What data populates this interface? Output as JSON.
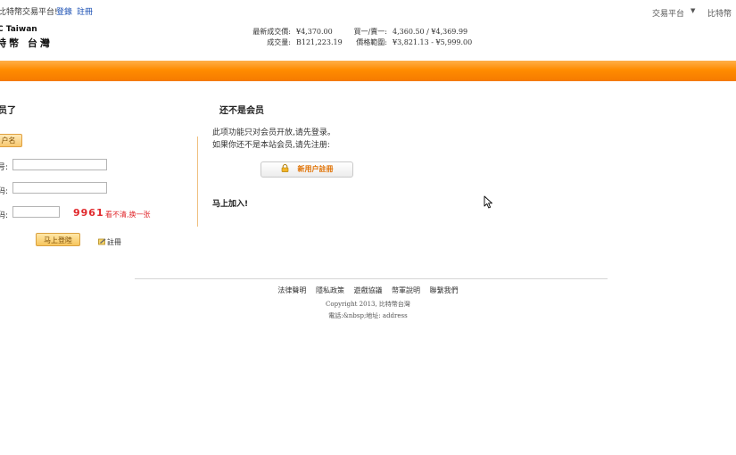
{
  "topbar": {
    "welcome": "比特幣交易平台!",
    "login_link": "登錄",
    "register_link": "註冊",
    "platform_menu": "交易平台",
    "brand_link": "比特幣"
  },
  "header": {
    "logo_en": "C Taiwan",
    "logo_cn": "特幣 台灣",
    "stats_left": [
      {
        "label": "最新成交價:",
        "value": "¥4,370.00"
      },
      {
        "label": "成交量:",
        "value": "B121,223.19"
      }
    ],
    "stats_right": [
      {
        "label": "買一/賣一:",
        "value": "4,360.50 / ¥4,369.99"
      },
      {
        "label": "價格範圍:",
        "value": "¥3,821.13 - ¥5,999.00"
      }
    ]
  },
  "login": {
    "title": "员了",
    "tab_label": "户名",
    "username_label": "号:",
    "password_label": "码:",
    "captcha_label": "码:",
    "captcha_code": "9961",
    "captcha_refresh": "看不清,换一张",
    "submit_label": "马上登陸",
    "register_label": "註冊"
  },
  "signup": {
    "title": "还不是会员",
    "line1": "此项功能只对会员开放,请先登录。",
    "line2": "如果你还不是本站会员,请先注册:",
    "button_label": "新用户註冊",
    "join_now": "马上加入!"
  },
  "footer": {
    "links": [
      "法律聲明",
      "隱私政策",
      "遊戲協議",
      "幣軍說明",
      "聯繫我們"
    ],
    "copyright": "Copyright 2013, 比特幣台灣",
    "contact": "電話:&nbsp;地址: address"
  },
  "colors": {
    "accent_orange": "#ff8c00",
    "link_blue": "#1a4fb3",
    "captcha_red": "#e0272b"
  }
}
